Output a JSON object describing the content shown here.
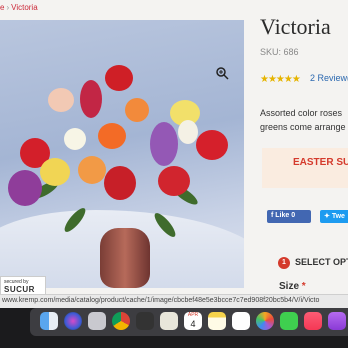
{
  "breadcrumb": {
    "prefix": "e",
    "current": "Victoria"
  },
  "product": {
    "title": "Victoria",
    "sku": "SKU: 686",
    "stars": "★★★★★",
    "reviews": "2 Review(",
    "description_lines": [
      "Assorted color roses",
      "greens come arrange"
    ],
    "promo": "EASTER SU"
  },
  "social": {
    "like": "Like 0",
    "tweet": "Twe"
  },
  "options": {
    "step": "1",
    "select_label": "SELECT OPT",
    "size_label": "Size",
    "required_mark": "*"
  },
  "secured_badge": {
    "label": "secured by",
    "brand": "SUCUR"
  },
  "status_url": "www.kremp.com/media/catalog/product/cache/1/image/cbcbef48e5e3bcce7c7ed908f20bc5b4/V/i/Victo",
  "dock": {
    "calendar_month": "APR",
    "calendar_day": "4",
    "apps": [
      "finder",
      "siri",
      "launchpad",
      "chrome",
      "calculator",
      "preview",
      "calendar",
      "notes",
      "reminders",
      "photos",
      "messages",
      "music",
      "podcasts"
    ]
  },
  "colors": {
    "accent": "#d43a2c",
    "link": "#2c69b0",
    "star": "#e6b400",
    "facebook": "#4267b2",
    "twitter": "#1d9bf0"
  }
}
